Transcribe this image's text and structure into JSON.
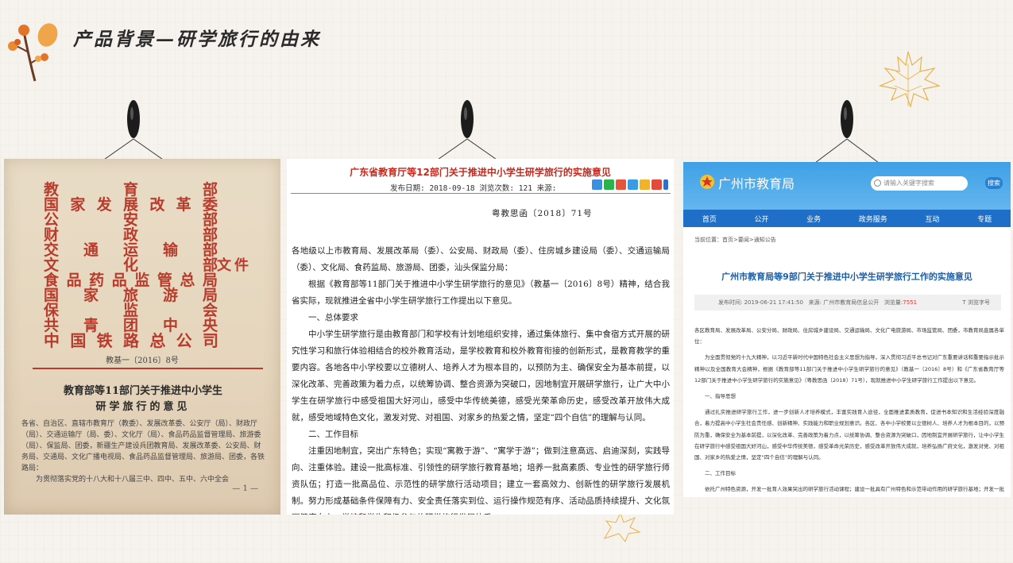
{
  "slide": {
    "title": "产品背景—研学旅行的由来"
  },
  "doc1": {
    "issuers": [
      [
        "教",
        "育",
        "部"
      ],
      [
        "国",
        "家",
        "发",
        "展",
        "改",
        "革",
        "委"
      ],
      [
        "公",
        "安",
        "部"
      ],
      [
        "财",
        "政",
        "部"
      ],
      [
        "交",
        "通",
        "运",
        "输",
        "部"
      ],
      [
        "文",
        "化",
        "部"
      ],
      [
        "食",
        "品",
        "药",
        "品",
        "监",
        "管",
        "总",
        "局"
      ],
      [
        "国",
        "家",
        "旅",
        "游",
        "局"
      ],
      [
        "保",
        "监",
        "会"
      ],
      [
        "共",
        "青",
        "团",
        "中",
        "央"
      ],
      [
        "中",
        "国",
        "铁",
        "路",
        "总",
        "公",
        "司"
      ]
    ],
    "wenjian": "文件",
    "doc_number": "教基一〔2016〕8号",
    "title_line1": "教育部等11部门关于推进中小学生",
    "title_line2": "研学旅行的意见",
    "body": "各省、自治区、直辖市教育厅（教委）、发展改革委、公安厅（局）、财政厅（局）、交通运输厅（局、委）、文化厅（局）、食品药品监督管理局、旅游委（局）、保监局、团委，新疆生产建设兵团教育局、发展改革委、公安局、财务局、交通局、文化广播电视局、食品药品监督管理局、旅游局、团委，各铁路局：",
    "body2": "为贯彻落实党的十八大和十八届三中、四中、五中、六中全会",
    "page": "— 1 —"
  },
  "doc2": {
    "title": "广东省教育厅等12部门关于推进中小学生研学旅行的实施意见",
    "meta": "发布日期: 2018-09-18 浏览次数: 121 来源:",
    "doc_number": "粤教思函〔2018〕71号",
    "paragraphs": [
      "各地级以上市教育局、发展改革局（委）、公安局、财政局（委）、住房城乡建设局（委）、交通运输局（委）、文化局、食药监局、旅游局、团委，汕头保监分局：",
      "根据《教育部等11部门关于推进中小学生研学旅行的意见》（教基一〔2016〕8号）精神，结合我省实际，现就推进全省中小学生研学旅行工作提出以下意见。",
      "一、总体要求",
      "中小学生研学旅行是由教育部门和学校有计划地组织安排，通过集体旅行、集中食宿方式开展的研究性学习和旅行体验相结合的校外教育活动，是学校教育和校外教育衔接的创新形式，是教育教学的重要内容。各地各中小学校要以立德树人、培养人才为根本目的，以预防为主、确保安全为基本前提，以深化改革、完善政策为着力点，以统筹协调、整合资源为突破口，因地制宜开展研学旅行，让广大中小学生在研学旅行中感受祖国大好河山，感受中华传统美德，感受光荣革命历史，感受改革开放伟大成就，感受地域特色文化，激发对党、对祖国、对家乡的热爱之情，坚定“四个自信”的理解与认同。",
      "二、工作目标",
      "注重因地制宜，突出广东特色；实现“寓教于游”、“寓学于游”；做到注意高远、启迪深刻，实践导向、注重体验。建设一批高标准、引领性的研学旅行教育基地；培养一批高素质、专业性的研学旅行师资队伍；打造一批高品位、示范性的研学旅行活动项目；建立一套高效力、创新性的研学旅行发展机制。努力形成基础条件保障有力、安全责任落实到位、运行操作规范有序、活动品质持续提升、文化氛围健康向上、学校和学生积极参与的研学旅行发展体系。"
    ]
  },
  "doc3": {
    "site_name": "广州市教育局",
    "search_placeholder": "请输入关键字搜索",
    "search_button": "搜索",
    "nav": [
      "首页",
      "公开",
      "业务",
      "政务服务",
      "互动",
      "专题"
    ],
    "breadcrumb": "当前位置：首页>要闻>通知公告",
    "title": "广州市教育局等9部门关于推进中小学生研学旅行工作的实施意见",
    "meta_date": "发布时间: 2019-06-21 17:41:50",
    "meta_source": "来源: 广州市教育局信息公开",
    "meta_views_label": "浏览量:",
    "meta_views": "7551",
    "meta_font": "T 浏览字号",
    "paragraphs": [
      "各区教育局、发展改革局、公安分局、财政局、住房城乡建设局、交通运输局、文化广电旅游局、市场监管局、团委，市教育局直属各单位：",
      "为全面贯彻党的十九大精神，以习近平新时代中国特色社会主义思想为指导，深入贯彻习近平总书记对广东重要讲话和重要指示批示精神以及全国教育大会精神，根据《教育部等11部门关于推进中小学生研学旅行的意见》（教基一〔2016〕8号）和《广东省教育厅等12部门关于推进中小学生研学旅行的实施意见》（粤教思函〔2018〕71号），现就推进中小学生研学旅行工作提出以下意见。",
      "一、指导思想",
      "通过扎实推进研学旅行工作，进一步创新人才培养模式，丰富实践育人途径，全面推进素质教育，促进书本知识和生活经验深度融合，着力提高中小学生社会责任感、创新精神、实践能力和职业规划意识。各区、各中小学校要以立德树人、培养人才为根本目的，以预防为重，确保安全为基本前提，以深化改革、完善政策为着力点，以统筹协调、整合资源为突破口，因地制宜开展研学旅行，让中小学生在研学旅行中感受祖国大好河山，感受中华传统美德，感受革命光荣历史，感受改革开放伟大成就，培养弘扬广府文化，激发对党、对祖国、对家乡的热爱之情，坚定“四个自信”的理解与认同。",
      "二、工作目标",
      "依托广州特色资源，开发一批育人效果突出的研学旅行活动课程；建设一批具有广州特色和示范带动作用的研学旅行基地；开发一批具有广州特色的精品研学旅行线路；培养一批高素质、专业性的研学旅行师资队伍；建立一套规范管理、责任清晰、多元筹资、保障安全的研学旅行工作机制，探索形成"
    ]
  }
}
